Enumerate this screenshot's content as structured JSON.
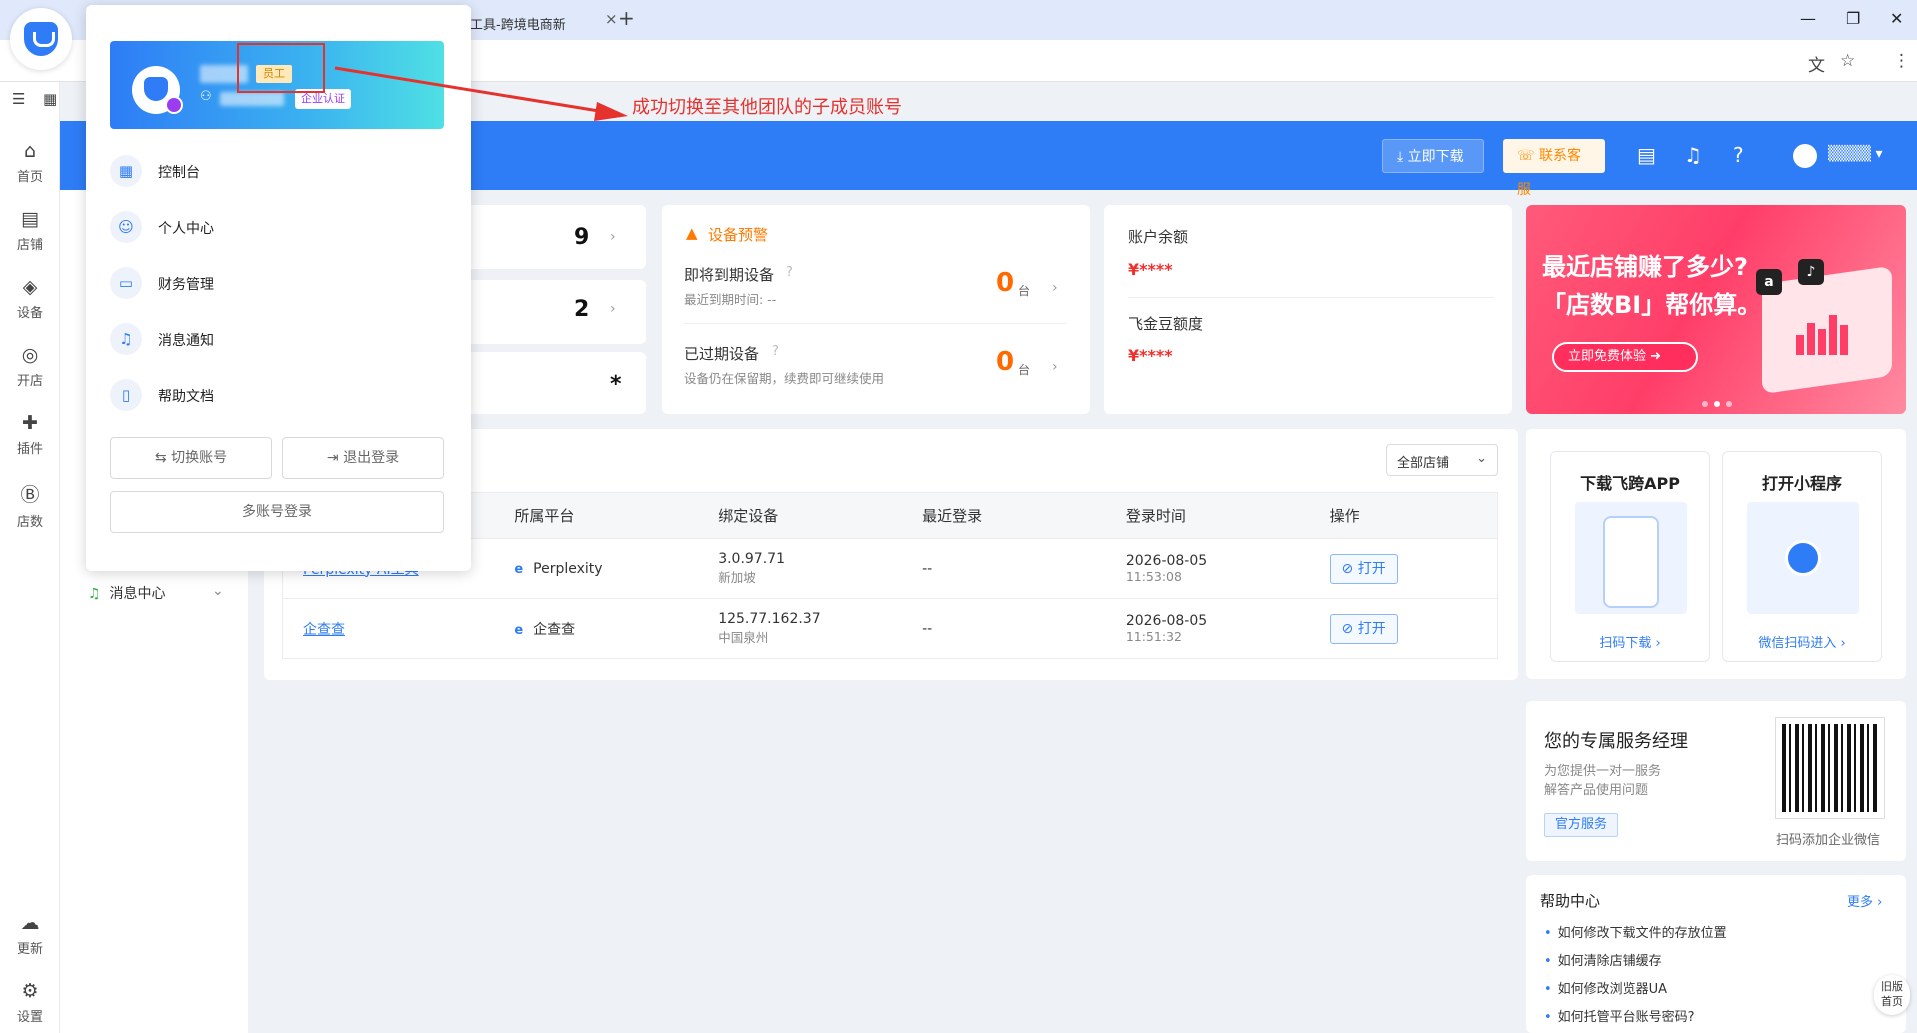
{
  "browser": {
    "tab_title": "工具-跨境电商新",
    "tab_close": "×",
    "new_tab": "+",
    "controls": [
      "—",
      "❐",
      "✕"
    ]
  },
  "nav": {
    "items": [
      {
        "label": "首页",
        "icon": "home-icon",
        "glyph": "⌂"
      },
      {
        "label": "店铺",
        "icon": "store-icon",
        "glyph": "▤"
      },
      {
        "label": "设备",
        "icon": "layers-icon",
        "glyph": "◈"
      },
      {
        "label": "开店",
        "icon": "planet-icon",
        "glyph": "◎"
      },
      {
        "label": "插件",
        "icon": "puzzle-icon",
        "glyph": "✚"
      },
      {
        "label": "店数",
        "icon": "bi-icon",
        "glyph": "Ⓑ"
      },
      {
        "label": "更新",
        "icon": "cloud-upload-icon",
        "glyph": "☁"
      },
      {
        "label": "设置",
        "icon": "settings-icon",
        "glyph": "⚙"
      }
    ]
  },
  "header": {
    "download_label": "立即下载",
    "service_label": "联系客服",
    "user_name": "▒▒▒▒"
  },
  "stats": {
    "row1_value": "9",
    "row2_value": "2",
    "row3_value": "*"
  },
  "device_alert": {
    "title": "设备预警",
    "expiring_label": "即将到期设备",
    "expiring_sub": "最近到期时间: --",
    "expiring_count": "0",
    "expired_label": "已过期设备",
    "expired_sub": "设备仍在保留期，续费即可继续使用",
    "expired_count": "0",
    "unit": "台"
  },
  "balance": {
    "account_label": "账户余额",
    "account_value": "¥****",
    "bean_label": "飞金豆额度",
    "bean_value": "¥****"
  },
  "banner": {
    "line1": "最近店铺赚了多少?",
    "line2": "「店数BI」帮你算。",
    "button": "立即免费体验 ➜",
    "amazon": "a",
    "tiktok": "♪"
  },
  "store_filter": {
    "label": "全部店铺"
  },
  "table": {
    "headers": [
      "",
      "所属平台",
      "绑定设备",
      "最近登录",
      "登录时间",
      "操作"
    ],
    "rows": [
      {
        "name": "Perplexity-AI工具",
        "platform": "Perplexity",
        "ip": "3.0.97.71",
        "region": "新加坡",
        "last_login": "--",
        "date": "2026-08-05",
        "time": "11:53:08",
        "action": "打开"
      },
      {
        "name": "企查查",
        "platform": "企查查",
        "ip": "125.77.162.37",
        "region": "中国泉州",
        "last_login": "--",
        "date": "2026-08-05",
        "time": "11:51:32",
        "action": "打开"
      }
    ]
  },
  "apps": {
    "download_title": "下载飞跨APP",
    "download_link": "扫码下载 ›",
    "mini_title": "打开小程序",
    "mini_link": "微信扫码进入 ›"
  },
  "manager": {
    "title": "您的专属服务经理",
    "sub1": "为您提供一对一服务",
    "sub2": "解答产品使用问题",
    "tag": "官方服务",
    "qr_caption": "扫码添加企业微信"
  },
  "help": {
    "title": "帮助中心",
    "more": "更多 ›",
    "items": [
      "如何修改下载文件的存放位置",
      "如何清除店铺缓存",
      "如何修改浏览器UA",
      "如何托管平台账号密码?"
    ]
  },
  "old_home": {
    "line1": "旧版",
    "line2": "首页"
  },
  "message_center": "消息中心",
  "popup": {
    "badge_staff": "员工",
    "badge_enterprise": "企业认证",
    "menu": [
      {
        "label": "控制台",
        "icon": "dashboard-icon",
        "glyph": "▦"
      },
      {
        "label": "个人中心",
        "icon": "user-icon",
        "glyph": "☺"
      },
      {
        "label": "财务管理",
        "icon": "wallet-icon",
        "glyph": "▭"
      },
      {
        "label": "消息通知",
        "icon": "bell-icon",
        "glyph": "♫"
      },
      {
        "label": "帮助文档",
        "icon": "book-icon",
        "glyph": "▯"
      }
    ],
    "switch_account": "⇆ 切换账号",
    "logout": "⇥ 退出登录",
    "multi_login": "多账号登录"
  },
  "annotation": "成功切换至其他团队的子成员账号",
  "colors": {
    "brand_blue": "#2e7cf6",
    "warning": "#ff7a00",
    "annotation_red": "#e5322d"
  }
}
